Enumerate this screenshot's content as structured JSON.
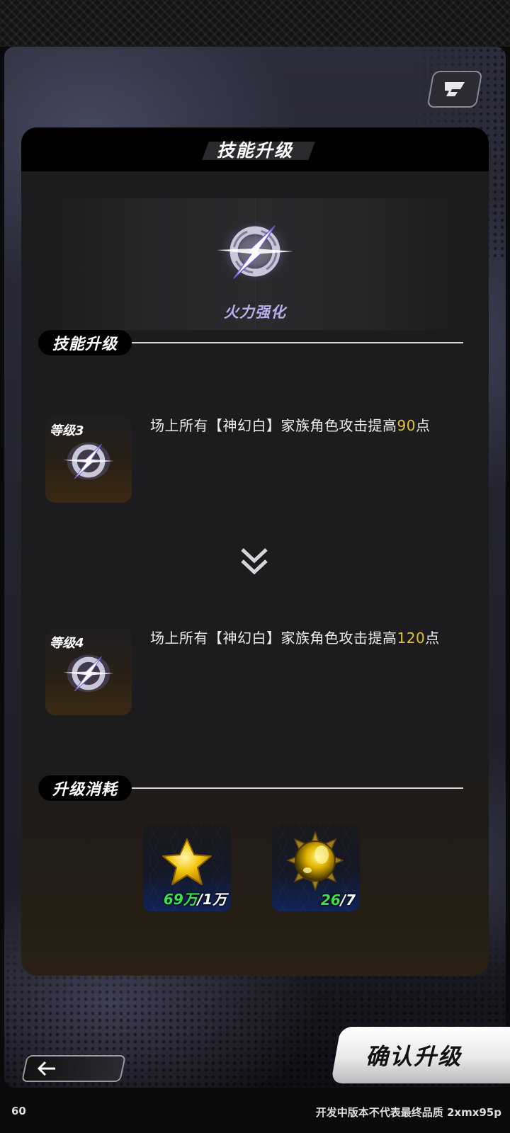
{
  "header": {
    "title": "技能升级"
  },
  "skill": {
    "name": "火力强化",
    "icon": "lightning-ring-icon"
  },
  "sections": {
    "upgrade_label": "技能升级",
    "cost_label": "升级消耗"
  },
  "levels": [
    {
      "label": "等级3",
      "desc_prefix": "场上所有【神幻白】家族角色攻击提高",
      "value": "90",
      "desc_suffix": "点"
    },
    {
      "label": "等级4",
      "desc_prefix": "场上所有【神幻白】家族角色攻击提高",
      "value": "120",
      "desc_suffix": "点"
    }
  ],
  "costs": [
    {
      "icon": "star-icon",
      "have": "69万",
      "need": "/1万"
    },
    {
      "icon": "spiked-orb-icon",
      "have": "26",
      "need": "/7"
    }
  ],
  "buttons": {
    "confirm": "确认升级",
    "back_icon": "arrow-left-icon"
  },
  "footer": {
    "fps": "60",
    "notice": "开发中版本不代表最终品质 2xmx95p"
  },
  "colors": {
    "highlight_value": "#e4c331",
    "have_amount": "#3fe04d",
    "skill_name": "#b9adf0"
  }
}
